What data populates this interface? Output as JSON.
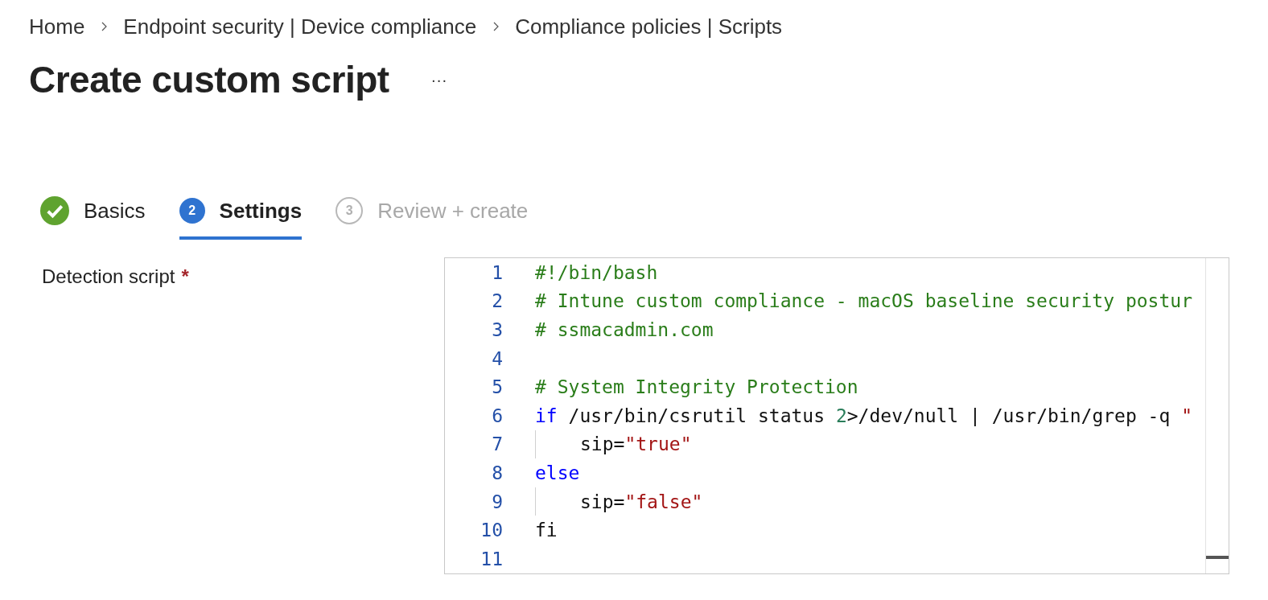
{
  "breadcrumb": [
    "Home",
    "Endpoint security | Device compliance",
    "Compliance policies | Scripts"
  ],
  "title": "Create custom script",
  "more": "···",
  "steps": [
    {
      "label": "Basics",
      "kind": "done",
      "selected": false
    },
    {
      "number": "2",
      "label": "Settings",
      "kind": "current",
      "selected": true
    },
    {
      "number": "3",
      "label": "Review + create",
      "kind": "pending",
      "selected": false
    }
  ],
  "field": {
    "label": "Detection script",
    "required": "*"
  },
  "editor": {
    "lines": [
      {
        "number": "1",
        "indented": false,
        "tokens": [
          {
            "kind": "comment",
            "text": "#!/bin/bash"
          }
        ]
      },
      {
        "number": "2",
        "indented": false,
        "tokens": [
          {
            "kind": "comment",
            "text": "# Intune custom compliance - macOS baseline security postur"
          }
        ]
      },
      {
        "number": "3",
        "indented": false,
        "tokens": [
          {
            "kind": "comment",
            "text": "# ssmacadmin.com"
          }
        ]
      },
      {
        "number": "4",
        "indented": false
      },
      {
        "number": "5",
        "indented": false,
        "tokens": [
          {
            "kind": "comment",
            "text": "# System Integrity Protection"
          }
        ]
      },
      {
        "number": "6",
        "indented": false,
        "tokens": [
          {
            "kind": "keyword",
            "text": "if"
          },
          {
            "kind": "plain",
            "text": " /usr/bin/csrutil status "
          },
          {
            "kind": "number",
            "text": "2"
          },
          {
            "kind": "plain",
            "text": ">/dev/null | /usr/bin/grep -q "
          },
          {
            "kind": "string",
            "text": "\""
          }
        ]
      },
      {
        "number": "7",
        "indented": true,
        "tokens": [
          {
            "kind": "plain",
            "text": "sip="
          },
          {
            "kind": "string",
            "text": "\"true\""
          }
        ]
      },
      {
        "number": "8",
        "indented": false,
        "tokens": [
          {
            "kind": "keyword",
            "text": "else"
          }
        ]
      },
      {
        "number": "9",
        "indented": true,
        "tokens": [
          {
            "kind": "plain",
            "text": "sip="
          },
          {
            "kind": "string",
            "text": "\"false\""
          }
        ]
      },
      {
        "number": "10",
        "indented": false,
        "tokens": [
          {
            "kind": "plain",
            "text": "fi"
          }
        ]
      },
      {
        "number": "11",
        "indented": false
      }
    ]
  }
}
